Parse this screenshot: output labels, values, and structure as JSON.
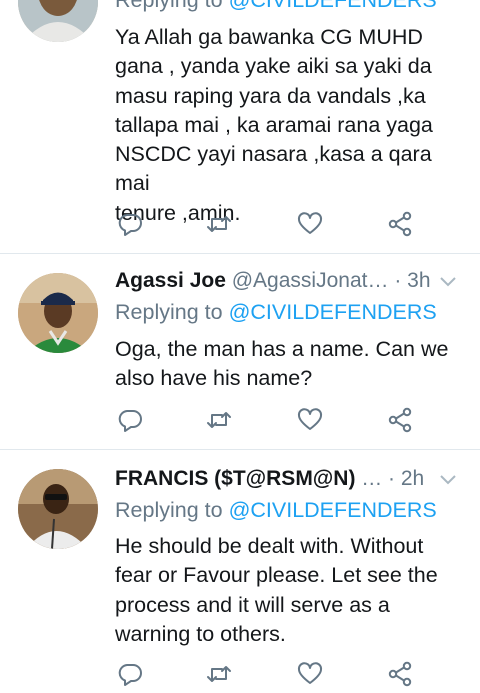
{
  "tweets": [
    {
      "name": "",
      "handle": "",
      "time": "",
      "replying_prefix": "Replying to",
      "replying_mention": "@CIVILDEFENDERS",
      "body_lines": [
        "Ya Allah ga bawanka CG MUHD",
        "gana , yanda yake aiki sa yaki da",
        "masu raping yara da vandals ,ka",
        "tallapa mai , ka aramai rana yaga",
        "NSCDC yayi nasara ,kasa a qara mai",
        "tenure ,amin."
      ]
    },
    {
      "name": "Agassi Joe",
      "handle": "@AgassiJonat…",
      "time": "· 3h",
      "replying_prefix": "Replying to",
      "replying_mention": "@CIVILDEFENDERS",
      "body_lines": [
        "Oga, the man has a name. Can we",
        "also have his name?"
      ]
    },
    {
      "name": "FRANCIS ($T@RSM@N)",
      "handle": "…",
      "time": "· 2h",
      "replying_prefix": "Replying to",
      "replying_mention": "@CIVILDEFENDERS",
      "body_lines": [
        "He should be dealt with. Without",
        "fear or Favour please. Let see the",
        "process and it will serve as a",
        "warning to others."
      ]
    }
  ],
  "icons": {
    "reply": "reply-icon",
    "retweet": "retweet-icon",
    "like": "like-icon",
    "share": "share-icon",
    "caret": "chevron-down-icon"
  },
  "colors": {
    "accent": "#1da1f2",
    "secondary_text": "#657786",
    "primary_text": "#14171a",
    "divider": "#e1e8ed"
  }
}
